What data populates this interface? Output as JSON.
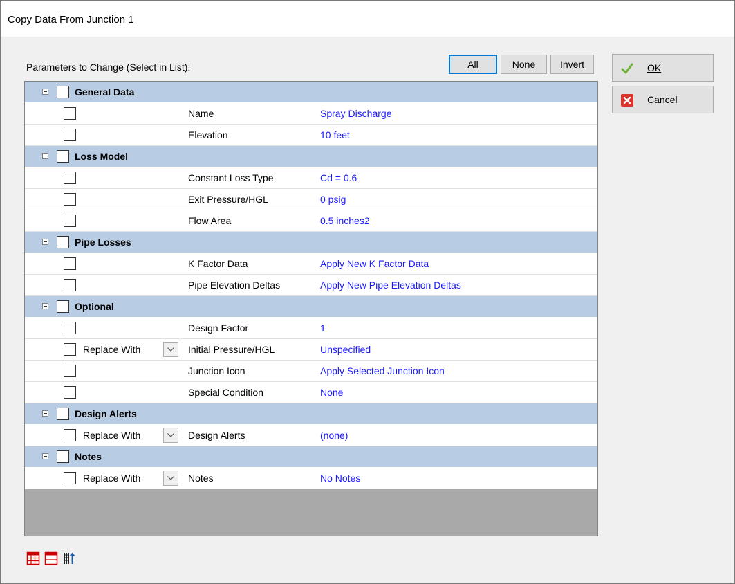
{
  "window": {
    "title": "Copy Data From Junction 1"
  },
  "params_label": "Parameters to Change (Select in List):",
  "buttons": {
    "all": "All",
    "none": "None",
    "invert": "Invert",
    "ok": "OK",
    "cancel": "Cancel"
  },
  "groups": {
    "general": {
      "label": "General Data",
      "rows": [
        {
          "param": "Name",
          "value": "Spray Discharge"
        },
        {
          "param": "Elevation",
          "value": "10 feet"
        }
      ]
    },
    "loss": {
      "label": "Loss Model",
      "rows": [
        {
          "param": "Constant Loss Type",
          "value": "Cd = 0.6"
        },
        {
          "param": "Exit Pressure/HGL",
          "value": "0 psig"
        },
        {
          "param": "Flow Area",
          "value": "0.5 inches2"
        }
      ]
    },
    "pipe": {
      "label": "Pipe Losses",
      "rows": [
        {
          "param": "K Factor Data",
          "value": "Apply New K Factor Data"
        },
        {
          "param": "Pipe Elevation Deltas",
          "value": "Apply New Pipe Elevation Deltas"
        }
      ]
    },
    "optional": {
      "label": "Optional",
      "rows": [
        {
          "param": "Design Factor",
          "value": "1"
        },
        {
          "param": "Initial Pressure/HGL",
          "value": "Unspecified",
          "replace": "Replace With"
        },
        {
          "param": "Junction Icon",
          "value": "Apply Selected Junction Icon"
        },
        {
          "param": "Special Condition",
          "value": "None"
        }
      ]
    },
    "alerts": {
      "label": "Design Alerts",
      "rows": [
        {
          "param": "Design Alerts",
          "value": "(none)",
          "replace": "Replace With"
        }
      ]
    },
    "notes": {
      "label": "Notes",
      "rows": [
        {
          "param": "Notes",
          "value": "No Notes",
          "replace": "Replace With"
        }
      ]
    }
  },
  "icons": {
    "ok": "check-icon",
    "cancel": "red-x-icon",
    "bottom": [
      "expand-all-grid-icon",
      "collapse-all-grid-icon",
      "sort-list-icon"
    ]
  },
  "colors": {
    "group_band": "#b8cce4",
    "value_text": "#1a1aff",
    "empty_grid": "#a9a9a9"
  }
}
